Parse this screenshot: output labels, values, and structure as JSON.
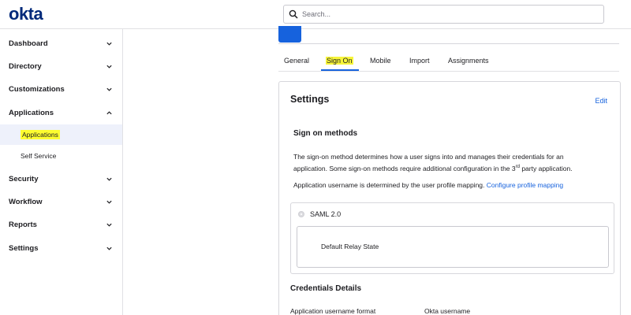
{
  "brand": {
    "logo_text": "okta"
  },
  "search": {
    "placeholder": "Search..."
  },
  "sidebar": {
    "items": [
      {
        "label": "Dashboard"
      },
      {
        "label": "Directory"
      },
      {
        "label": "Customizations"
      },
      {
        "label": "Applications"
      },
      {
        "label": "Security"
      },
      {
        "label": "Workflow"
      },
      {
        "label": "Reports"
      },
      {
        "label": "Settings"
      }
    ],
    "sub_items": [
      {
        "label": "Applications"
      },
      {
        "label": "Self Service"
      }
    ]
  },
  "tabs": [
    {
      "label": "General"
    },
    {
      "label": "Sign On"
    },
    {
      "label": "Mobile"
    },
    {
      "label": "Import"
    },
    {
      "label": "Assignments"
    }
  ],
  "settings": {
    "title": "Settings",
    "edit_label": "Edit",
    "sign_on_methods_title": "Sign on methods",
    "description_line1": "The sign-on method determines how a user signs into and manages their credentials for an",
    "description_line2_pre": "application. Some sign-on methods require additional configuration in the 3",
    "description_line2_sup": "rd",
    "description_line2_post": " party application.",
    "username_text": "Application username is determined by the user profile mapping. ",
    "configure_link": "Configure profile mapping",
    "saml_label": "SAML 2.0",
    "relay_state_label": "Default Relay State",
    "credentials_title": "Credentials Details",
    "username_format_label": "Application username format",
    "username_format_value": "Okta username"
  },
  "colors": {
    "accent": "#1662dd",
    "logo": "#00297a",
    "highlight": "#fdfd30"
  }
}
